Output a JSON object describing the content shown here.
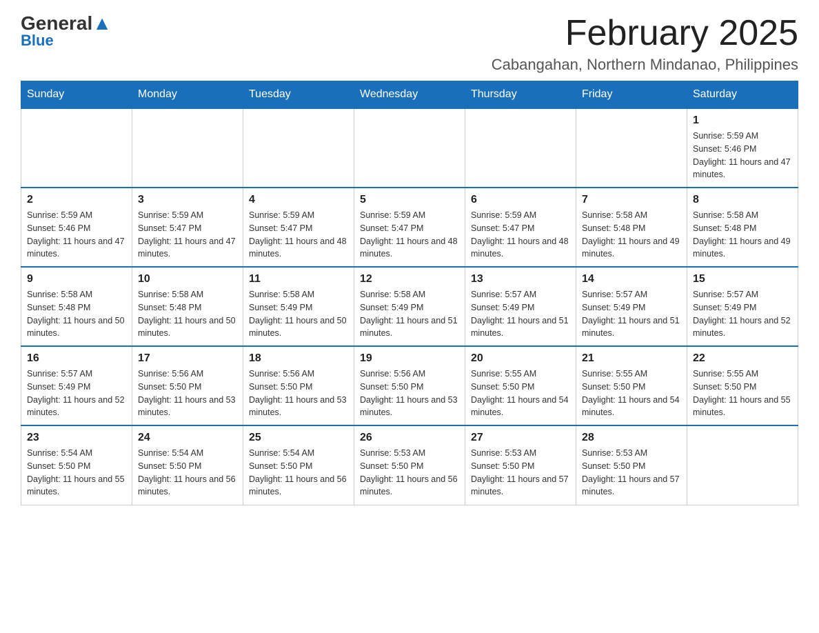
{
  "header": {
    "logo_general": "General",
    "logo_blue": "Blue",
    "month_title": "February 2025",
    "location": "Cabangahan, Northern Mindanao, Philippines"
  },
  "days_of_week": [
    "Sunday",
    "Monday",
    "Tuesday",
    "Wednesday",
    "Thursday",
    "Friday",
    "Saturday"
  ],
  "weeks": [
    [
      {
        "day": "",
        "info": ""
      },
      {
        "day": "",
        "info": ""
      },
      {
        "day": "",
        "info": ""
      },
      {
        "day": "",
        "info": ""
      },
      {
        "day": "",
        "info": ""
      },
      {
        "day": "",
        "info": ""
      },
      {
        "day": "1",
        "info": "Sunrise: 5:59 AM\nSunset: 5:46 PM\nDaylight: 11 hours and 47 minutes."
      }
    ],
    [
      {
        "day": "2",
        "info": "Sunrise: 5:59 AM\nSunset: 5:46 PM\nDaylight: 11 hours and 47 minutes."
      },
      {
        "day": "3",
        "info": "Sunrise: 5:59 AM\nSunset: 5:47 PM\nDaylight: 11 hours and 47 minutes."
      },
      {
        "day": "4",
        "info": "Sunrise: 5:59 AM\nSunset: 5:47 PM\nDaylight: 11 hours and 48 minutes."
      },
      {
        "day": "5",
        "info": "Sunrise: 5:59 AM\nSunset: 5:47 PM\nDaylight: 11 hours and 48 minutes."
      },
      {
        "day": "6",
        "info": "Sunrise: 5:59 AM\nSunset: 5:47 PM\nDaylight: 11 hours and 48 minutes."
      },
      {
        "day": "7",
        "info": "Sunrise: 5:58 AM\nSunset: 5:48 PM\nDaylight: 11 hours and 49 minutes."
      },
      {
        "day": "8",
        "info": "Sunrise: 5:58 AM\nSunset: 5:48 PM\nDaylight: 11 hours and 49 minutes."
      }
    ],
    [
      {
        "day": "9",
        "info": "Sunrise: 5:58 AM\nSunset: 5:48 PM\nDaylight: 11 hours and 50 minutes."
      },
      {
        "day": "10",
        "info": "Sunrise: 5:58 AM\nSunset: 5:48 PM\nDaylight: 11 hours and 50 minutes."
      },
      {
        "day": "11",
        "info": "Sunrise: 5:58 AM\nSunset: 5:49 PM\nDaylight: 11 hours and 50 minutes."
      },
      {
        "day": "12",
        "info": "Sunrise: 5:58 AM\nSunset: 5:49 PM\nDaylight: 11 hours and 51 minutes."
      },
      {
        "day": "13",
        "info": "Sunrise: 5:57 AM\nSunset: 5:49 PM\nDaylight: 11 hours and 51 minutes."
      },
      {
        "day": "14",
        "info": "Sunrise: 5:57 AM\nSunset: 5:49 PM\nDaylight: 11 hours and 51 minutes."
      },
      {
        "day": "15",
        "info": "Sunrise: 5:57 AM\nSunset: 5:49 PM\nDaylight: 11 hours and 52 minutes."
      }
    ],
    [
      {
        "day": "16",
        "info": "Sunrise: 5:57 AM\nSunset: 5:49 PM\nDaylight: 11 hours and 52 minutes."
      },
      {
        "day": "17",
        "info": "Sunrise: 5:56 AM\nSunset: 5:50 PM\nDaylight: 11 hours and 53 minutes."
      },
      {
        "day": "18",
        "info": "Sunrise: 5:56 AM\nSunset: 5:50 PM\nDaylight: 11 hours and 53 minutes."
      },
      {
        "day": "19",
        "info": "Sunrise: 5:56 AM\nSunset: 5:50 PM\nDaylight: 11 hours and 53 minutes."
      },
      {
        "day": "20",
        "info": "Sunrise: 5:55 AM\nSunset: 5:50 PM\nDaylight: 11 hours and 54 minutes."
      },
      {
        "day": "21",
        "info": "Sunrise: 5:55 AM\nSunset: 5:50 PM\nDaylight: 11 hours and 54 minutes."
      },
      {
        "day": "22",
        "info": "Sunrise: 5:55 AM\nSunset: 5:50 PM\nDaylight: 11 hours and 55 minutes."
      }
    ],
    [
      {
        "day": "23",
        "info": "Sunrise: 5:54 AM\nSunset: 5:50 PM\nDaylight: 11 hours and 55 minutes."
      },
      {
        "day": "24",
        "info": "Sunrise: 5:54 AM\nSunset: 5:50 PM\nDaylight: 11 hours and 56 minutes."
      },
      {
        "day": "25",
        "info": "Sunrise: 5:54 AM\nSunset: 5:50 PM\nDaylight: 11 hours and 56 minutes."
      },
      {
        "day": "26",
        "info": "Sunrise: 5:53 AM\nSunset: 5:50 PM\nDaylight: 11 hours and 56 minutes."
      },
      {
        "day": "27",
        "info": "Sunrise: 5:53 AM\nSunset: 5:50 PM\nDaylight: 11 hours and 57 minutes."
      },
      {
        "day": "28",
        "info": "Sunrise: 5:53 AM\nSunset: 5:50 PM\nDaylight: 11 hours and 57 minutes."
      },
      {
        "day": "",
        "info": ""
      }
    ]
  ]
}
